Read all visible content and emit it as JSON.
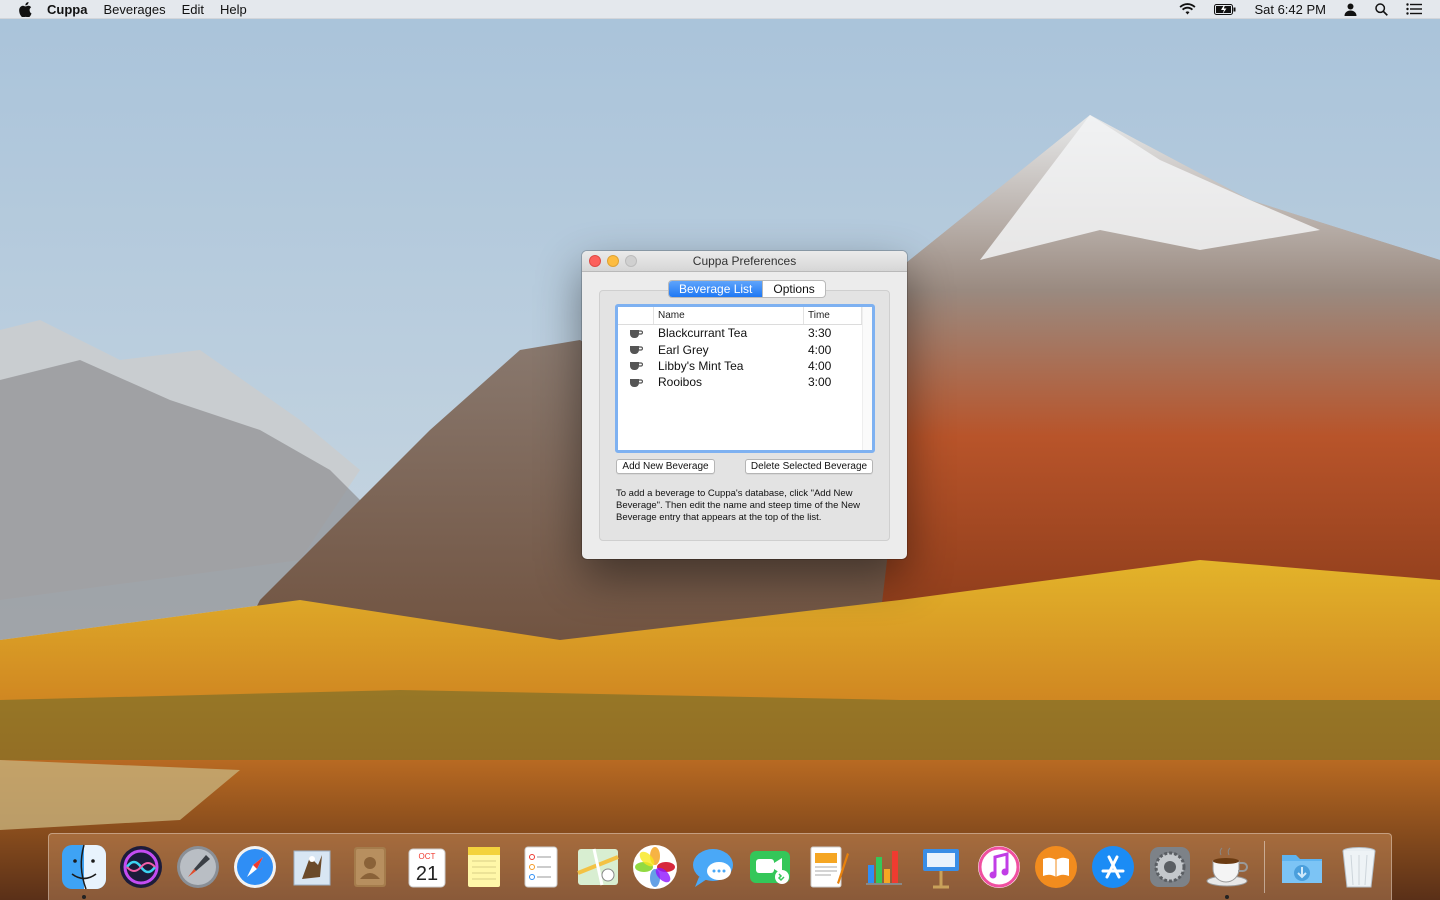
{
  "menubar": {
    "app_name": "Cuppa",
    "menus": [
      "Beverages",
      "Edit",
      "Help"
    ],
    "clock": "Sat 6:42 PM"
  },
  "window": {
    "title": "Cuppa Preferences",
    "tabs": [
      {
        "label": "Beverage List",
        "active": true
      },
      {
        "label": "Options",
        "active": false
      }
    ],
    "table": {
      "columns": [
        "Name",
        "Time"
      ],
      "rows": [
        {
          "name": "Blackcurrant Tea",
          "time": "3:30"
        },
        {
          "name": "Earl Grey",
          "time": "4:00"
        },
        {
          "name": "Libby's Mint Tea",
          "time": "4:00"
        },
        {
          "name": "Rooibos",
          "time": "3:00"
        }
      ]
    },
    "buttons": {
      "add": "Add New Beverage",
      "delete": "Delete Selected Beverage"
    },
    "help_text": "To add a beverage to Cuppa's database, click \"Add New Beverage\".  Then edit the name and steep time of the New Beverage entry that appears at the top of the list."
  },
  "dock": {
    "calendar": {
      "month": "OCT",
      "day": "21"
    },
    "items": [
      "finder-icon",
      "siri-icon",
      "launchpad-icon",
      "safari-icon",
      "mail-icon",
      "contacts-icon",
      "calendar-icon",
      "notes-icon",
      "reminders-icon",
      "maps-icon",
      "photos-icon",
      "messages-icon",
      "facetime-icon",
      "pages-icon",
      "numbers-icon",
      "keynote-icon",
      "itunes-icon",
      "ibooks-icon",
      "app-store-icon",
      "system-preferences-icon",
      "cuppa-icon",
      "downloads-icon",
      "trash-icon"
    ]
  },
  "colors": {
    "accent": "#1f78f4",
    "focus_ring": "#7eb1f1",
    "close": "#fc605c",
    "minimize": "#fdbc40"
  }
}
